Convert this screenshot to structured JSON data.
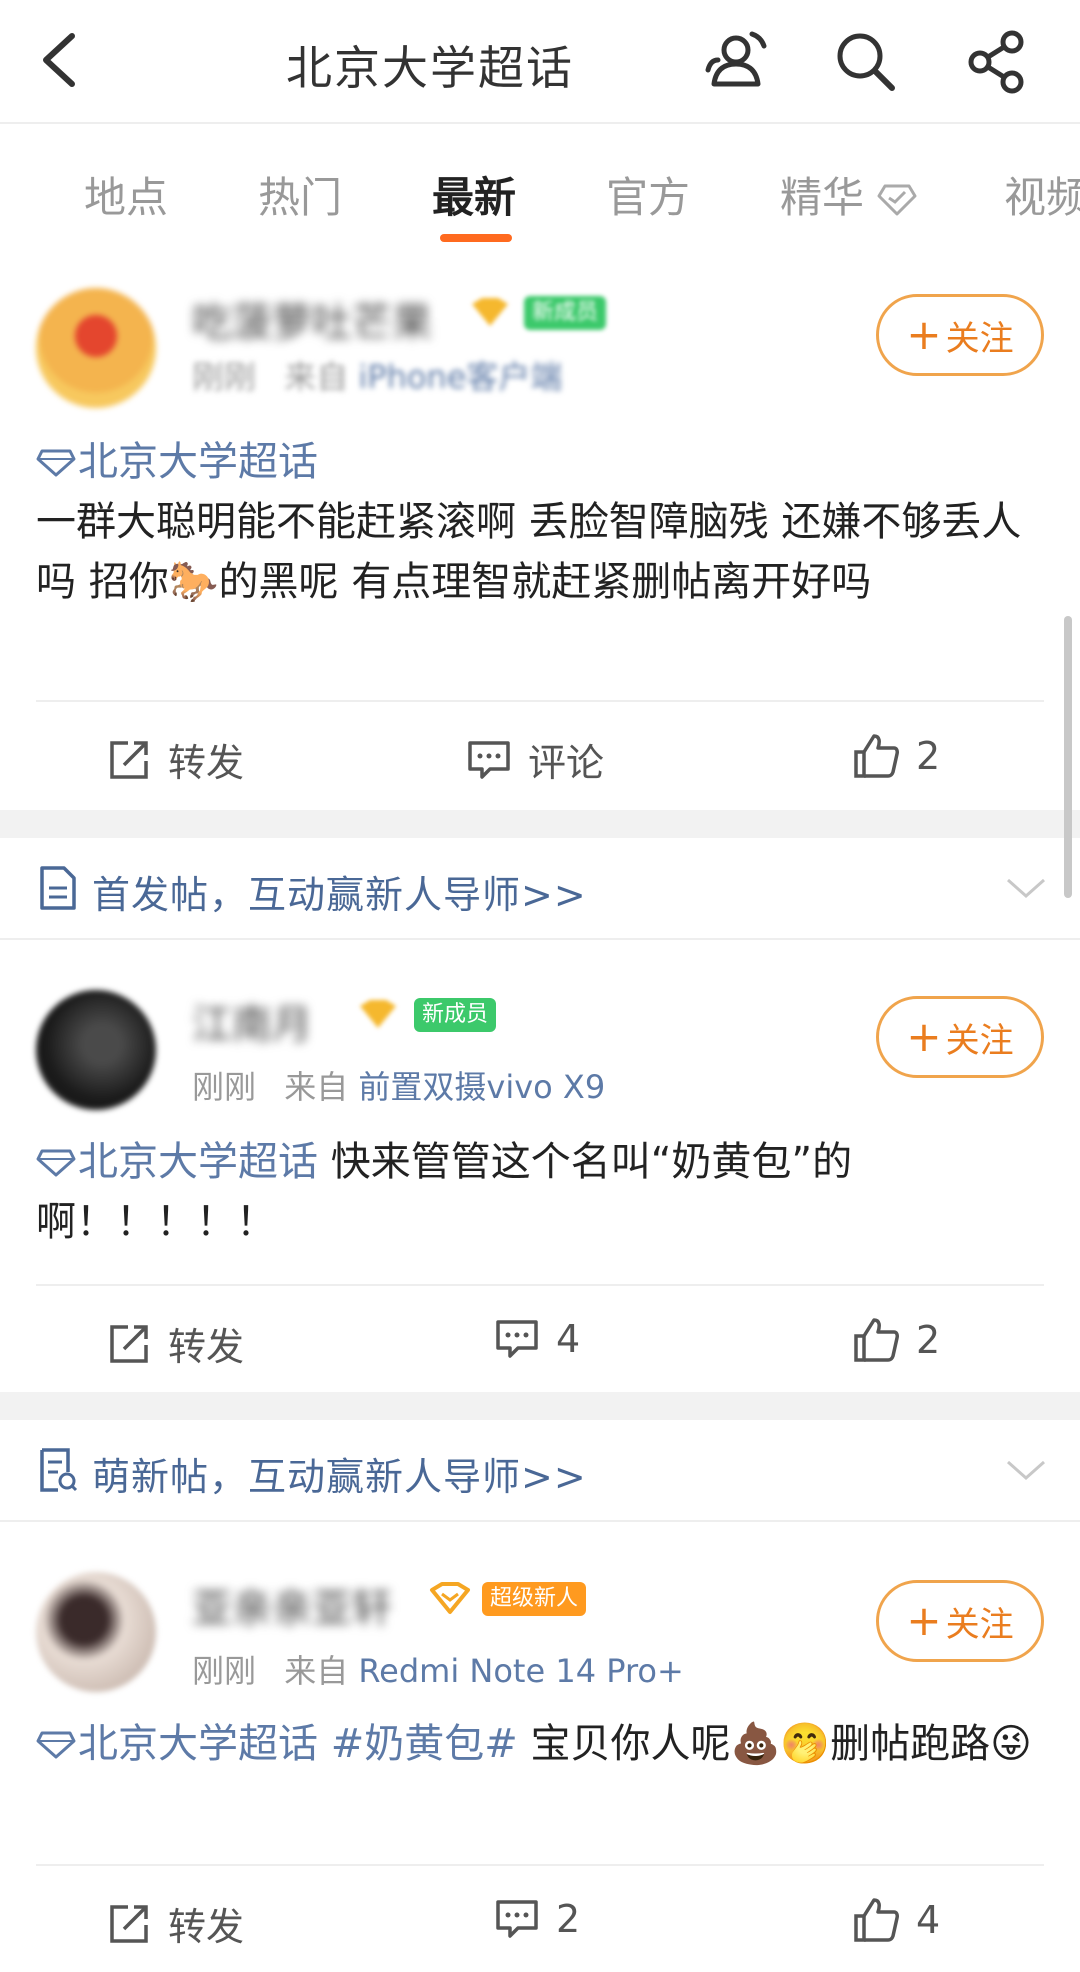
{
  "header": {
    "title": "北京大学超话",
    "icons": [
      "back-icon",
      "members-icon",
      "search-icon",
      "share-icon"
    ]
  },
  "tabs": [
    "地点",
    "热门",
    "最新",
    "官方",
    "精华",
    "视频"
  ],
  "active_tab": "最新",
  "accent_color": "#ff6a1f",
  "link_color": "#5d7aa7",
  "posts": [
    {
      "username": "吃菠萝吐芒果",
      "badge": "新成员",
      "meta_time": "刚刚",
      "meta_from": "来自",
      "meta_source": "iPhone客户端",
      "follow_label": "关注",
      "topic": "北京大学超话",
      "text_before_emoji": "一群大聪明能不能赶紧滚啊 丢脸智障脑残 还嫌不够丢人吗 招你",
      "emoji": "🐎",
      "text_after_emoji": "的黑呢 有点理智就赶紧删帖离开好吗",
      "repost_label": "转发",
      "comment_label": "评论",
      "like_count": "2"
    },
    {
      "username": "江南月",
      "badge": "新成员",
      "meta_time": "刚刚",
      "meta_from": "来自",
      "meta_source": "前置双摄vivo X9",
      "follow_label": "关注",
      "topic": "北京大学超话",
      "text": "  快来管管这个名叫“奶黄包”的啊！！！！！",
      "repost_label": "转发",
      "comment_count": "4",
      "like_count": "2"
    },
    {
      "username": "亚亲亲亚轩",
      "badge": "超级新人",
      "meta_time": "刚刚",
      "meta_from": "来自",
      "meta_source": "Redmi Note 14 Pro+",
      "follow_label": "关注",
      "topic": "北京大学超话",
      "hashtag": " #奶黄包#",
      "text_main": " 宝贝你人呢",
      "emoji_a": "💩🤭",
      "text_tail": "删帖跑路",
      "emoji_b": "😜",
      "repost_label": "转发",
      "comment_count": "2",
      "like_count": "4"
    }
  ],
  "banners": [
    {
      "icon": "document-icon",
      "text": "首发帖，互动赢新人导师>>"
    },
    {
      "icon": "clipboard-icon",
      "text": "萌新帖，互动赢新人导师>>"
    }
  ]
}
